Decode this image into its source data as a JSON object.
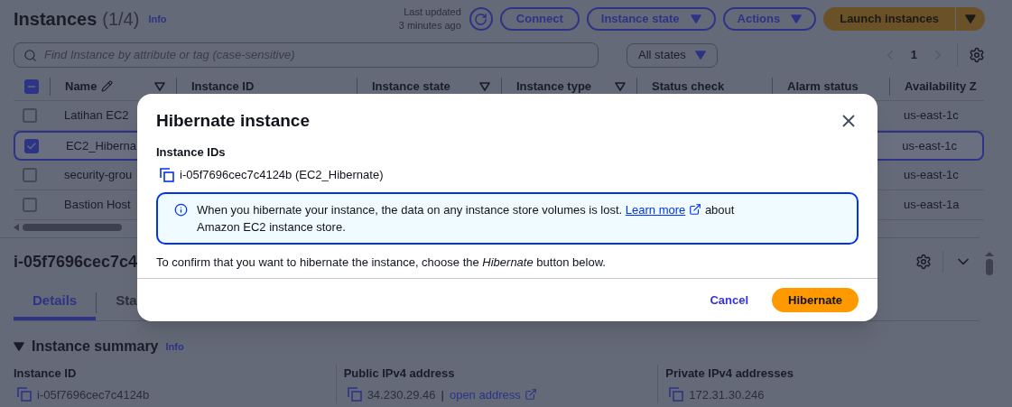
{
  "header": {
    "title": "Instances",
    "count": "(1/4)",
    "info": "Info",
    "last_updated": [
      "Last updated",
      "3 minutes ago"
    ]
  },
  "toolbar_buttons": [
    {
      "label": "Connect",
      "kind": "plain"
    },
    {
      "label": "Instance state",
      "kind": "dropdown"
    },
    {
      "label": "Actions",
      "kind": "dropdown"
    },
    {
      "label": "Launch instances",
      "kind": "split"
    }
  ],
  "search": {
    "placeholder": "Find Instance by attribute or tag (case-sensitive)"
  },
  "state_filter": {
    "label": "All states"
  },
  "pagination": {
    "page": "1"
  },
  "table": {
    "select_all": {
      "indeterminate": true
    },
    "columns": [
      {
        "label": "Name",
        "editable": true,
        "filter": true
      },
      {
        "label": "Instance ID",
        "editable": false,
        "filter": false
      },
      {
        "label": "Instance state",
        "editable": false,
        "filter": true
      },
      {
        "label": "Instance type",
        "editable": false,
        "filter": true
      },
      {
        "label": "Status check",
        "editable": false,
        "filter": false
      },
      {
        "label": "Alarm status",
        "editable": false,
        "filter": false
      },
      {
        "label": "Availability Z",
        "editable": false,
        "filter": false
      }
    ],
    "rows": [
      {
        "name": "Latihan EC2",
        "availability_zone": "us-east-1c",
        "selected": false
      },
      {
        "name": "EC2_Hiberna",
        "availability_zone": "us-east-1c",
        "selected": true
      },
      {
        "name": "security-grou",
        "availability_zone": "us-east-1c",
        "selected": false
      },
      {
        "name": "Bastion Host",
        "availability_zone": "us-east-1a",
        "selected": false
      }
    ]
  },
  "detail": {
    "title": "i-05f7696cec7c4",
    "tabs": [
      {
        "label": "Details",
        "selected": true
      },
      {
        "label": "Sta",
        "selected": false
      }
    ],
    "section": {
      "title": "Instance summary",
      "info": "Info",
      "expanded": true
    },
    "fields": [
      {
        "label": "Instance ID",
        "value": "i-05f7696cec7c4124b"
      },
      {
        "label": "Public IPv4 address",
        "value": "34.230.29.46",
        "separator": "|",
        "link": "open address"
      },
      {
        "label": "Private IPv4 addresses",
        "value": "172.31.30.246"
      }
    ]
  },
  "modal": {
    "title": "Hibernate instance",
    "ids_label": "Instance IDs",
    "ids": [
      "i-05f7696cec7c4124b (EC2_Hibernate)"
    ],
    "alert": {
      "before": "When you hibernate your instance, the data on any instance store volumes is lost.",
      "link": "Learn more",
      "after": "about Amazon EC2 instance store."
    },
    "confirm": "To confirm that you want to hibernate the instance, choose the *Hibernate* button below.",
    "buttons": [
      {
        "label": "Cancel",
        "kind": "link"
      },
      {
        "label": "Hibernate",
        "kind": "primary"
      }
    ]
  }
}
